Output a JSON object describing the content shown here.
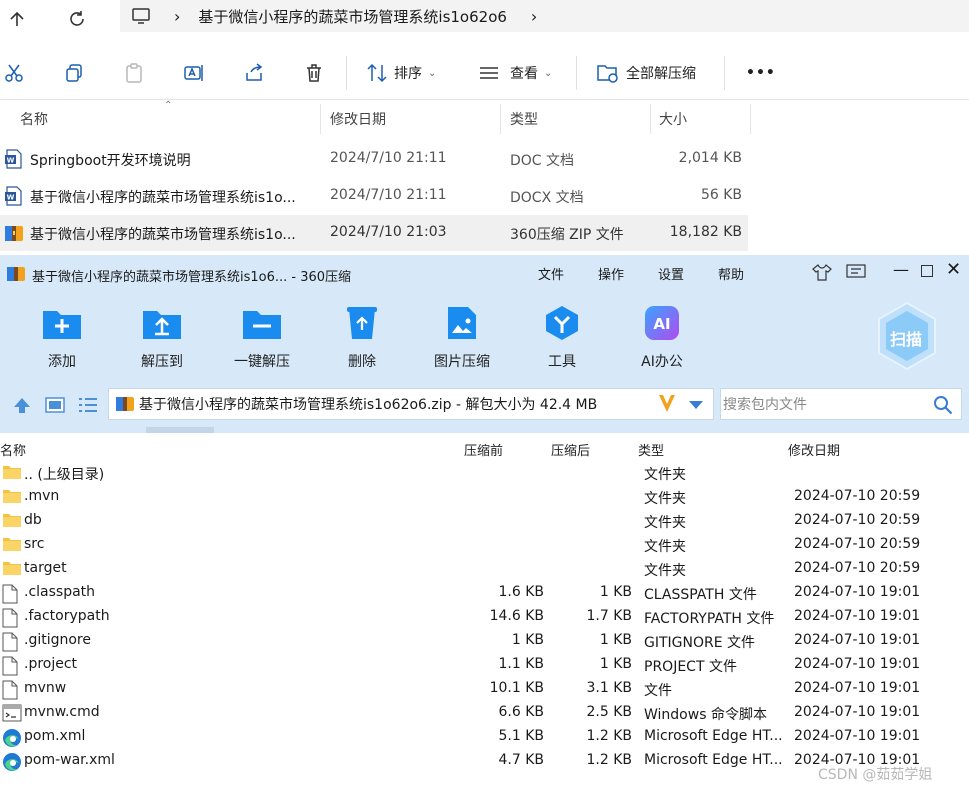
{
  "explorer": {
    "breadcrumb": "基于微信小程序的蔬菜市场管理系统is1o62o6",
    "ribbon": {
      "sort_label": "排序",
      "view_label": "查看",
      "extract_all_label": "全部解压缩",
      "more_label": "•••"
    },
    "columns": [
      "名称",
      "修改日期",
      "类型",
      "大小"
    ],
    "files": [
      {
        "name": "Springboot开发环境说明",
        "date": "2024/7/10 21:11",
        "type": "DOC 文档",
        "size": "2,014 KB",
        "icon": "word-icon"
      },
      {
        "name": "基于微信小程序的蔬菜市场管理系统is1o...",
        "date": "2024/7/10 21:11",
        "type": "DOCX 文档",
        "size": "56 KB",
        "icon": "word-icon"
      },
      {
        "name": "基于微信小程序的蔬菜市场管理系统is1o...",
        "date": "2024/7/10 21:03",
        "type": "360压缩 ZIP 文件",
        "size": "18,182 KB",
        "icon": "zip-icon"
      }
    ]
  },
  "zip_window": {
    "title": "基于微信小程序的蔬菜市场管理系统is1o6... - 360压缩",
    "menu": [
      "文件",
      "操作",
      "设置",
      "帮助"
    ],
    "tools": [
      "添加",
      "解压到",
      "一键解压",
      "删除",
      "图片压缩",
      "工具",
      "AI办公"
    ],
    "scan_label": "扫描",
    "path_text": "基于微信小程序的蔬菜市场管理系统is1o62o6.zip - 解包大小为 42.4 MB",
    "search_placeholder": "搜索包内文件",
    "columns": [
      "名称",
      "压缩前",
      "压缩后",
      "类型",
      "修改日期"
    ],
    "rows": [
      {
        "name": ".. (上级目录)",
        "before": "",
        "after": "",
        "type": "文件夹",
        "date": "",
        "kind": "folder"
      },
      {
        "name": ".mvn",
        "before": "",
        "after": "",
        "type": "文件夹",
        "date": "2024-07-10 20:59",
        "kind": "folder"
      },
      {
        "name": "db",
        "before": "",
        "after": "",
        "type": "文件夹",
        "date": "2024-07-10 20:59",
        "kind": "folder"
      },
      {
        "name": "src",
        "before": "",
        "after": "",
        "type": "文件夹",
        "date": "2024-07-10 20:59",
        "kind": "folder"
      },
      {
        "name": "target",
        "before": "",
        "after": "",
        "type": "文件夹",
        "date": "2024-07-10 20:59",
        "kind": "folder"
      },
      {
        "name": ".classpath",
        "before": "1.6 KB",
        "after": "1 KB",
        "type": "CLASSPATH 文件",
        "date": "2024-07-10 19:01",
        "kind": "file"
      },
      {
        "name": ".factorypath",
        "before": "14.6 KB",
        "after": "1.7 KB",
        "type": "FACTORYPATH 文件",
        "date": "2024-07-10 19:01",
        "kind": "file"
      },
      {
        "name": ".gitignore",
        "before": "1 KB",
        "after": "1 KB",
        "type": "GITIGNORE 文件",
        "date": "2024-07-10 19:01",
        "kind": "file"
      },
      {
        "name": ".project",
        "before": "1.1 KB",
        "after": "1 KB",
        "type": "PROJECT 文件",
        "date": "2024-07-10 19:01",
        "kind": "file"
      },
      {
        "name": "mvnw",
        "before": "10.1 KB",
        "after": "3.1 KB",
        "type": "文件",
        "date": "2024-07-10 19:01",
        "kind": "file"
      },
      {
        "name": "mvnw.cmd",
        "before": "6.6 KB",
        "after": "2.5 KB",
        "type": "Windows 命令脚本",
        "date": "2024-07-10 19:01",
        "kind": "cmd"
      },
      {
        "name": "pom.xml",
        "before": "5.1 KB",
        "after": "1.2 KB",
        "type": "Microsoft Edge HT...",
        "date": "2024-07-10 19:01",
        "kind": "edge"
      },
      {
        "name": "pom-war.xml",
        "before": "4.7 KB",
        "after": "1.2 KB",
        "type": "Microsoft Edge HT...",
        "date": "2024-07-10 19:01",
        "kind": "edge"
      }
    ]
  },
  "watermark": "CSDN @茹茹学姐"
}
